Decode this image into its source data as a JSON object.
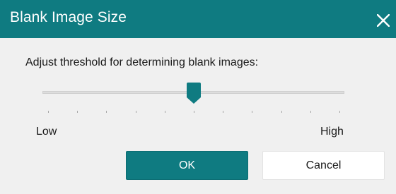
{
  "window": {
    "title": "Blank Image Size",
    "titlebar_color": "#0f7b81",
    "close_icon": "close-icon"
  },
  "main": {
    "prompt": "Adjust threshold for determining blank images:",
    "slider": {
      "min_label": "Low",
      "max_label": "High",
      "value": 0.5,
      "tick_count": 11
    }
  },
  "buttons": {
    "ok_label": "OK",
    "cancel_label": "Cancel",
    "ok_color": "#0f7b81"
  }
}
